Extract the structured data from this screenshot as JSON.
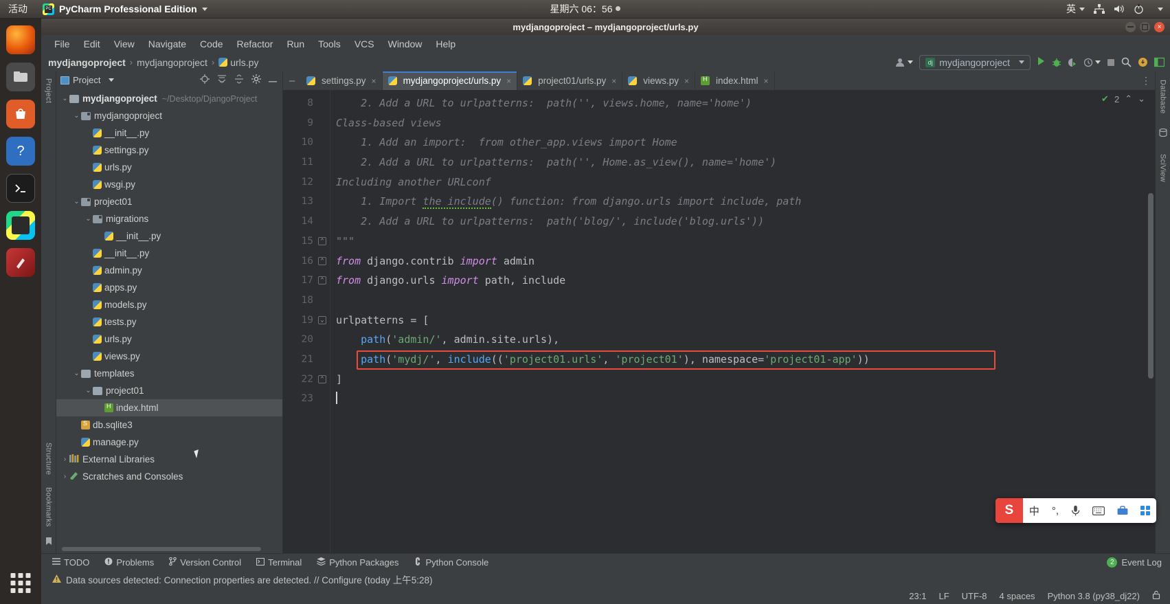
{
  "desktop": {
    "activities": "活动",
    "app_name": "PyCharm Professional Edition",
    "clock": "星期六 06：56",
    "tray": {
      "input_method": "英",
      "network_icon": "network-icon",
      "volume_icon": "volume-icon",
      "power_icon": "power-icon"
    },
    "launcher": [
      {
        "name": "firefox",
        "label": "Firefox"
      },
      {
        "name": "files",
        "label": "Files"
      },
      {
        "name": "software",
        "label": "Ubuntu Software"
      },
      {
        "name": "help",
        "label": "Help"
      },
      {
        "name": "terminal",
        "label": "Terminal"
      },
      {
        "name": "pycharm",
        "label": "PyCharm"
      },
      {
        "name": "inkscape",
        "label": "Inkscape"
      }
    ]
  },
  "window": {
    "title": "mydjangoproject – mydjangoproject/urls.py",
    "minimize": "–",
    "maximize": "□",
    "close": "×"
  },
  "menu": [
    {
      "label": "File",
      "mnemonic": "F",
      "rest": "ile"
    },
    {
      "label": "Edit",
      "mnemonic": "E",
      "rest": "dit"
    },
    {
      "label": "View",
      "mnemonic": "V",
      "rest": "iew"
    },
    {
      "label": "Navigate",
      "mnemonic": "N",
      "rest": "avigate"
    },
    {
      "label": "Code",
      "mnemonic": "C",
      "rest": "ode"
    },
    {
      "label": "Refactor",
      "mnemonic": "R",
      "rest": "efactor"
    },
    {
      "label": "Run",
      "mnemonic": "R",
      "rest": "un"
    },
    {
      "label": "Tools",
      "mnemonic": "T",
      "rest": "ools"
    },
    {
      "label": "VCS",
      "mnemonic": "S",
      "rest": "VCS"
    },
    {
      "label": "Window",
      "mnemonic": "W",
      "rest": "indow"
    },
    {
      "label": "Help",
      "mnemonic": "H",
      "rest": "elp"
    }
  ],
  "navbar": {
    "crumbs": [
      "mydjangoproject",
      "mydjangoproject",
      "urls.py"
    ],
    "separator": "›",
    "run_config": "mydjangoproject",
    "run_config_icon": "django-icon",
    "profile_icon": "user-icon",
    "run_icon": "run-icon",
    "debug_icon": "debug-icon",
    "coverage_icon": "coverage-icon",
    "profiler_icon": "profiler-icon",
    "stop_icon": "stop-icon",
    "search_icon": "search-icon",
    "updates_icon": "updates-icon",
    "layout_icon": "layout-icon"
  },
  "project_panel": {
    "title": "Project",
    "tools": [
      "locate-icon",
      "expand-all-icon",
      "collapse-all-icon",
      "settings-icon",
      "hide-icon"
    ],
    "tree": [
      {
        "depth": 0,
        "arrow": "v",
        "icon": "folder",
        "label": "mydjangoproject",
        "bold": true,
        "path": "~/Desktop/DjangoProject",
        "selected": false
      },
      {
        "depth": 1,
        "arrow": "v",
        "icon": "module",
        "label": "mydjangoproject",
        "bold": false,
        "path": "",
        "selected": false
      },
      {
        "depth": 2,
        "arrow": "",
        "icon": "py",
        "label": "__init__.py",
        "bold": false,
        "path": "",
        "selected": false
      },
      {
        "depth": 2,
        "arrow": "",
        "icon": "py",
        "label": "settings.py",
        "bold": false,
        "path": "",
        "selected": false
      },
      {
        "depth": 2,
        "arrow": "",
        "icon": "py",
        "label": "urls.py",
        "bold": false,
        "path": "",
        "selected": false
      },
      {
        "depth": 2,
        "arrow": "",
        "icon": "py",
        "label": "wsgi.py",
        "bold": false,
        "path": "",
        "selected": false
      },
      {
        "depth": 1,
        "arrow": "v",
        "icon": "module",
        "label": "project01",
        "bold": false,
        "path": "",
        "selected": false
      },
      {
        "depth": 2,
        "arrow": "v",
        "icon": "module",
        "label": "migrations",
        "bold": false,
        "path": "",
        "selected": false
      },
      {
        "depth": 3,
        "arrow": "",
        "icon": "py",
        "label": "__init__.py",
        "bold": false,
        "path": "",
        "selected": false
      },
      {
        "depth": 2,
        "arrow": "",
        "icon": "py",
        "label": "__init__.py",
        "bold": false,
        "path": "",
        "selected": false
      },
      {
        "depth": 2,
        "arrow": "",
        "icon": "py",
        "label": "admin.py",
        "bold": false,
        "path": "",
        "selected": false
      },
      {
        "depth": 2,
        "arrow": "",
        "icon": "py",
        "label": "apps.py",
        "bold": false,
        "path": "",
        "selected": false
      },
      {
        "depth": 2,
        "arrow": "",
        "icon": "py",
        "label": "models.py",
        "bold": false,
        "path": "",
        "selected": false
      },
      {
        "depth": 2,
        "arrow": "",
        "icon": "py",
        "label": "tests.py",
        "bold": false,
        "path": "",
        "selected": false
      },
      {
        "depth": 2,
        "arrow": "",
        "icon": "py",
        "label": "urls.py",
        "bold": false,
        "path": "",
        "selected": false
      },
      {
        "depth": 2,
        "arrow": "",
        "icon": "py",
        "label": "views.py",
        "bold": false,
        "path": "",
        "selected": false
      },
      {
        "depth": 1,
        "arrow": "v",
        "icon": "folder",
        "label": "templates",
        "bold": false,
        "path": "",
        "selected": false
      },
      {
        "depth": 2,
        "arrow": "v",
        "icon": "folder",
        "label": "project01",
        "bold": false,
        "path": "",
        "selected": false
      },
      {
        "depth": 3,
        "arrow": "",
        "icon": "html",
        "label": "index.html",
        "bold": false,
        "path": "",
        "selected": true
      },
      {
        "depth": 1,
        "arrow": "",
        "icon": "sql",
        "label": "db.sqlite3",
        "bold": false,
        "path": "",
        "selected": false
      },
      {
        "depth": 1,
        "arrow": "",
        "icon": "py",
        "label": "manage.py",
        "bold": false,
        "path": "",
        "selected": false
      },
      {
        "depth": 0,
        "arrow": ">",
        "icon": "lib",
        "label": "External Libraries",
        "bold": false,
        "path": "",
        "selected": false
      },
      {
        "depth": 0,
        "arrow": ">",
        "icon": "scratch",
        "label": "Scratches and Consoles",
        "bold": false,
        "path": "",
        "selected": false
      }
    ]
  },
  "left_rail": {
    "project": "Project",
    "structure": "Structure",
    "bookmarks": "Bookmarks"
  },
  "right_rail": {
    "database": "Database",
    "sciview": "SciView"
  },
  "tabs": [
    {
      "label": "settings.py",
      "icon": "py",
      "active": false
    },
    {
      "label": "mydjangoproject/urls.py",
      "icon": "py",
      "active": true
    },
    {
      "label": "project01/urls.py",
      "icon": "py",
      "active": false
    },
    {
      "label": "views.py",
      "icon": "py",
      "active": false
    },
    {
      "label": "index.html",
      "icon": "html",
      "active": false
    }
  ],
  "editor": {
    "warning_count": "2",
    "lines": [
      {
        "num": "8",
        "segments": [
          {
            "t": "    2. Add a URL to urlpatterns:  path('', views.home, name='home')",
            "c": "doc"
          }
        ]
      },
      {
        "num": "9",
        "segments": [
          {
            "t": "Class-based views",
            "c": "doc"
          }
        ]
      },
      {
        "num": "10",
        "segments": [
          {
            "t": "    1. Add an import:  from other_app.views import Home",
            "c": "doc"
          }
        ]
      },
      {
        "num": "11",
        "segments": [
          {
            "t": "    2. Add a URL to urlpatterns:  path('', Home.as_view(), name='home')",
            "c": "doc"
          }
        ]
      },
      {
        "num": "12",
        "segments": [
          {
            "t": "Including another URLconf",
            "c": "doc"
          }
        ]
      },
      {
        "num": "13",
        "segments": [
          {
            "t": "    1. Import ",
            "c": "doc"
          },
          {
            "t": "the include",
            "c": "doc squig"
          },
          {
            "t": "() function: from django.urls import include, path",
            "c": "doc"
          }
        ]
      },
      {
        "num": "14",
        "segments": [
          {
            "t": "    2. Add a URL to urlpatterns:  path('blog/', include('blog.urls'))",
            "c": "doc"
          }
        ]
      },
      {
        "num": "15",
        "segments": [
          {
            "t": "\"\"\"",
            "c": "doc"
          }
        ]
      },
      {
        "num": "16",
        "segments": [
          {
            "t": "from",
            "c": "kw"
          },
          {
            "t": " django.contrib ",
            "c": "plain"
          },
          {
            "t": "import",
            "c": "kw"
          },
          {
            "t": " admin",
            "c": "plain"
          }
        ]
      },
      {
        "num": "17",
        "segments": [
          {
            "t": "from",
            "c": "kw"
          },
          {
            "t": " django.urls ",
            "c": "plain"
          },
          {
            "t": "import",
            "c": "kw"
          },
          {
            "t": " path, include",
            "c": "plain"
          }
        ]
      },
      {
        "num": "18",
        "segments": [
          {
            "t": "",
            "c": "plain"
          }
        ]
      },
      {
        "num": "19",
        "segments": [
          {
            "t": "urlpatterns = [",
            "c": "plain"
          }
        ]
      },
      {
        "num": "20",
        "segments": [
          {
            "t": "    ",
            "c": "plain"
          },
          {
            "t": "path",
            "c": "fn"
          },
          {
            "t": "(",
            "c": "plain"
          },
          {
            "t": "'admin/'",
            "c": "str"
          },
          {
            "t": ", admin.site.urls),",
            "c": "plain"
          }
        ]
      },
      {
        "num": "21",
        "segments": [
          {
            "t": "    ",
            "c": "plain"
          },
          {
            "t": "path",
            "c": "fn"
          },
          {
            "t": "(",
            "c": "plain"
          },
          {
            "t": "'mydj/'",
            "c": "str"
          },
          {
            "t": ", ",
            "c": "plain"
          },
          {
            "t": "include",
            "c": "fn"
          },
          {
            "t": "((",
            "c": "plain"
          },
          {
            "t": "'project01.urls'",
            "c": "str"
          },
          {
            "t": ", ",
            "c": "plain"
          },
          {
            "t": "'project01'",
            "c": "str"
          },
          {
            "t": "), namespace=",
            "c": "plain"
          },
          {
            "t": "'project01-app'",
            "c": "str"
          },
          {
            "t": "))",
            "c": "plain"
          }
        ]
      },
      {
        "num": "22",
        "segments": [
          {
            "t": "]",
            "c": "plain"
          }
        ]
      },
      {
        "num": "23",
        "segments": [
          {
            "t": "",
            "c": "plain"
          }
        ]
      }
    ]
  },
  "ime": {
    "logo": "S",
    "mode": "中",
    "punct": "°,",
    "mic_icon": "microphone-icon",
    "keyboard_icon": "keyboard-icon",
    "toolbox_icon": "toolbox-icon",
    "menu_icon": "menu-icon"
  },
  "bottom_tools": [
    {
      "label": "TODO",
      "icon": "todo-icon"
    },
    {
      "label": "Problems",
      "icon": "problems-icon"
    },
    {
      "label": "Version Control",
      "icon": "vcs-icon"
    },
    {
      "label": "Terminal",
      "icon": "terminal-icon"
    },
    {
      "label": "Python Packages",
      "icon": "packages-icon"
    },
    {
      "label": "Python Console",
      "icon": "console-icon"
    }
  ],
  "event_log": {
    "label": "Event Log",
    "count": "2"
  },
  "notification": {
    "icon": "warning-icon",
    "text": "Data sources detected: Connection properties are detected. // Configure (today 上午5:28)"
  },
  "statusbar": {
    "caret": "23:1",
    "line_sep": "LF",
    "encoding": "UTF-8",
    "indent": "4 spaces",
    "interpreter": "Python 3.8 (py38_dj22)",
    "lock_icon": "lock-icon"
  },
  "colors": {
    "accent_blue": "#3d7fd4",
    "error_red": "#e74c3c",
    "string_green": "#6aab73",
    "keyword_purple": "#cf8ee5",
    "function_blue": "#56a8f5",
    "panel_bg": "#3c3f41",
    "editor_bg": "#2b2d30"
  }
}
